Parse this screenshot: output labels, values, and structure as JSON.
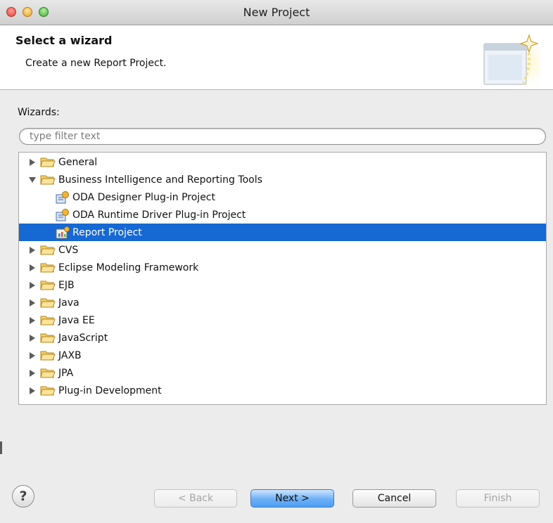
{
  "window": {
    "title": "New Project"
  },
  "header": {
    "title": "Select a wizard",
    "description": "Create a new Report Project."
  },
  "wizards": {
    "label": "Wizards:",
    "filter_placeholder": "type filter text",
    "filter_value": ""
  },
  "tree": {
    "items": [
      {
        "label": "General",
        "icon": "folder-icon",
        "expanded": false
      },
      {
        "label": "Business Intelligence and Reporting Tools",
        "icon": "folder-icon",
        "expanded": true
      },
      {
        "label": "ODA Designer Plug-in Project",
        "icon": "plugin-project-icon"
      },
      {
        "label": "ODA Runtime Driver Plug-in Project",
        "icon": "plugin-project-icon"
      },
      {
        "label": "Report Project",
        "icon": "report-project-icon",
        "selected": true
      },
      {
        "label": "CVS",
        "icon": "folder-icon",
        "expanded": false
      },
      {
        "label": "Eclipse Modeling Framework",
        "icon": "folder-icon",
        "expanded": false
      },
      {
        "label": "EJB",
        "icon": "folder-icon",
        "expanded": false
      },
      {
        "label": "Java",
        "icon": "folder-icon",
        "expanded": false
      },
      {
        "label": "Java EE",
        "icon": "folder-icon",
        "expanded": false
      },
      {
        "label": "JavaScript",
        "icon": "folder-icon",
        "expanded": false
      },
      {
        "label": "JAXB",
        "icon": "folder-icon",
        "expanded": false
      },
      {
        "label": "JPA",
        "icon": "folder-icon",
        "expanded": false
      },
      {
        "label": "Plug-in Development",
        "icon": "folder-icon",
        "expanded": false
      }
    ]
  },
  "footer": {
    "help_symbol": "?",
    "back_label": "< Back",
    "next_label": "Next >",
    "cancel_label": "Cancel",
    "finish_label": "Finish"
  },
  "colors": {
    "selection": "#1668d3",
    "folder": "#f2c94c",
    "default_button": "#6cb0f6"
  }
}
